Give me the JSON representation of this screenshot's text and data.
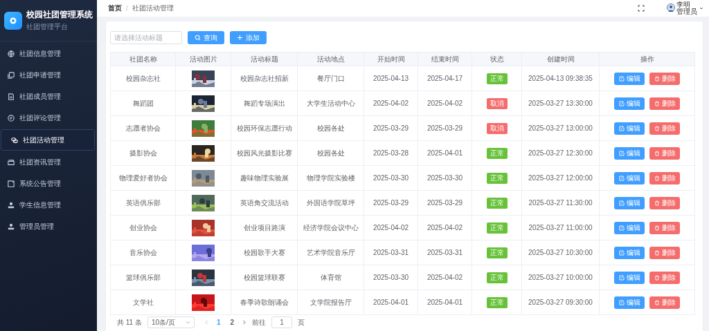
{
  "sidebar": {
    "title": "校园社团管理系统",
    "subtitle": "社团管理平台",
    "items": [
      {
        "label": "社团信息管理",
        "selected": false
      },
      {
        "label": "社团申请管理",
        "selected": false
      },
      {
        "label": "社团成员管理",
        "selected": false
      },
      {
        "label": "社团评论管理",
        "selected": false
      },
      {
        "label": "社团活动管理",
        "selected": true
      },
      {
        "label": "社团资讯管理",
        "selected": false
      },
      {
        "label": "系统公告管理",
        "selected": false
      },
      {
        "label": "学生信息管理",
        "selected": false
      },
      {
        "label": "管理员管理",
        "selected": false
      }
    ]
  },
  "header": {
    "breadcrumb": [
      "首页",
      "社团活动管理"
    ],
    "separator": "/",
    "user": {
      "name": "李明",
      "role": "管理员"
    }
  },
  "toolbar": {
    "search": {
      "placeholder": "请选择活动标题"
    },
    "buttons": [
      {
        "label": "查询",
        "kind": "search"
      },
      {
        "label": "添加",
        "kind": "add"
      }
    ]
  },
  "table": {
    "columns": [
      "社团名称",
      "活动图片",
      "活动标题",
      "活动地点",
      "开始时间",
      "结束时间",
      "状态",
      "创建时间",
      "操作"
    ],
    "rows": [
      {
        "club": "校园杂志社",
        "title": "校园杂志社招新",
        "place": "餐厅门口",
        "start": "2025-04-13",
        "end": "2025-04-17",
        "status": {
          "label": "正常",
          "kind": "normal"
        },
        "created": "2025-04-13 09:38:35",
        "actions": [
          {
            "label": "编辑",
            "kind": "edit"
          },
          {
            "label": "删除",
            "kind": "delete"
          }
        ]
      },
      {
        "club": "舞蹈团",
        "title": "舞蹈专场演出",
        "place": "大学生活动中心",
        "start": "2025-04-02",
        "end": "2025-04-02",
        "status": {
          "label": "取消",
          "kind": "cancelled"
        },
        "created": "2025-03-27 13:30:00",
        "actions": [
          {
            "label": "编辑",
            "kind": "edit"
          },
          {
            "label": "删除",
            "kind": "delete"
          }
        ]
      },
      {
        "club": "志愿者协会",
        "title": "校园环保志愿行动",
        "place": "校园各处",
        "start": "2025-03-29",
        "end": "2025-03-29",
        "status": {
          "label": "取消",
          "kind": "cancelled"
        },
        "created": "2025-03-27 13:00:00",
        "actions": [
          {
            "label": "编辑",
            "kind": "edit"
          },
          {
            "label": "删除",
            "kind": "delete"
          }
        ]
      },
      {
        "club": "摄影协会",
        "title": "校园风光摄影比赛",
        "place": "校园各处",
        "start": "2025-03-28",
        "end": "2025-04-01",
        "status": {
          "label": "正常",
          "kind": "normal"
        },
        "created": "2025-03-27 12:30:00",
        "actions": [
          {
            "label": "编辑",
            "kind": "edit"
          },
          {
            "label": "删除",
            "kind": "delete"
          }
        ]
      },
      {
        "club": "物理爱好者协会",
        "title": "趣味物理实验展",
        "place": "物理学院实验楼",
        "start": "2025-03-30",
        "end": "2025-03-30",
        "status": {
          "label": "正常",
          "kind": "normal"
        },
        "created": "2025-03-27 12:00:00",
        "actions": [
          {
            "label": "编辑",
            "kind": "edit"
          },
          {
            "label": "删除",
            "kind": "delete"
          }
        ]
      },
      {
        "club": "英语俱乐部",
        "title": "英语角交流活动",
        "place": "外国语学院草坪",
        "start": "2025-03-29",
        "end": "2025-03-29",
        "status": {
          "label": "正常",
          "kind": "normal"
        },
        "created": "2025-03-27 11:30:00",
        "actions": [
          {
            "label": "编辑",
            "kind": "edit"
          },
          {
            "label": "删除",
            "kind": "delete"
          }
        ]
      },
      {
        "club": "创业协会",
        "title": "创业项目路演",
        "place": "经济学院会议中心",
        "start": "2025-04-02",
        "end": "2025-04-02",
        "status": {
          "label": "正常",
          "kind": "normal"
        },
        "created": "2025-03-27 11:00:00",
        "actions": [
          {
            "label": "编辑",
            "kind": "edit"
          },
          {
            "label": "删除",
            "kind": "delete"
          }
        ]
      },
      {
        "club": "音乐协会",
        "title": "校园歌手大赛",
        "place": "艺术学院音乐厅",
        "start": "2025-03-31",
        "end": "2025-03-31",
        "status": {
          "label": "正常",
          "kind": "normal"
        },
        "created": "2025-03-27 10:30:00",
        "actions": [
          {
            "label": "编辑",
            "kind": "edit"
          },
          {
            "label": "删除",
            "kind": "delete"
          }
        ]
      },
      {
        "club": "篮球俱乐部",
        "title": "校园篮球联赛",
        "place": "体育馆",
        "start": "2025-03-30",
        "end": "2025-04-02",
        "status": {
          "label": "正常",
          "kind": "normal"
        },
        "created": "2025-03-27 10:00:00",
        "actions": [
          {
            "label": "编辑",
            "kind": "edit"
          },
          {
            "label": "删除",
            "kind": "delete"
          }
        ]
      },
      {
        "club": "文学社",
        "title": "春季诗歌朗诵会",
        "place": "文学院报告厅",
        "start": "2025-04-01",
        "end": "2025-04-01",
        "status": {
          "label": "正常",
          "kind": "normal"
        },
        "created": "2025-03-27 09:30:00",
        "actions": [
          {
            "label": "编辑",
            "kind": "edit"
          },
          {
            "label": "删除",
            "kind": "delete"
          }
        ]
      }
    ]
  },
  "pagination": {
    "total": "共 11 条",
    "page_size": "10条/页",
    "pages": [
      {
        "label": "1",
        "selected": true
      },
      {
        "label": "2",
        "selected": false
      }
    ],
    "goto_label": "前往",
    "goto_value": "1",
    "goto_suffix": "页"
  }
}
